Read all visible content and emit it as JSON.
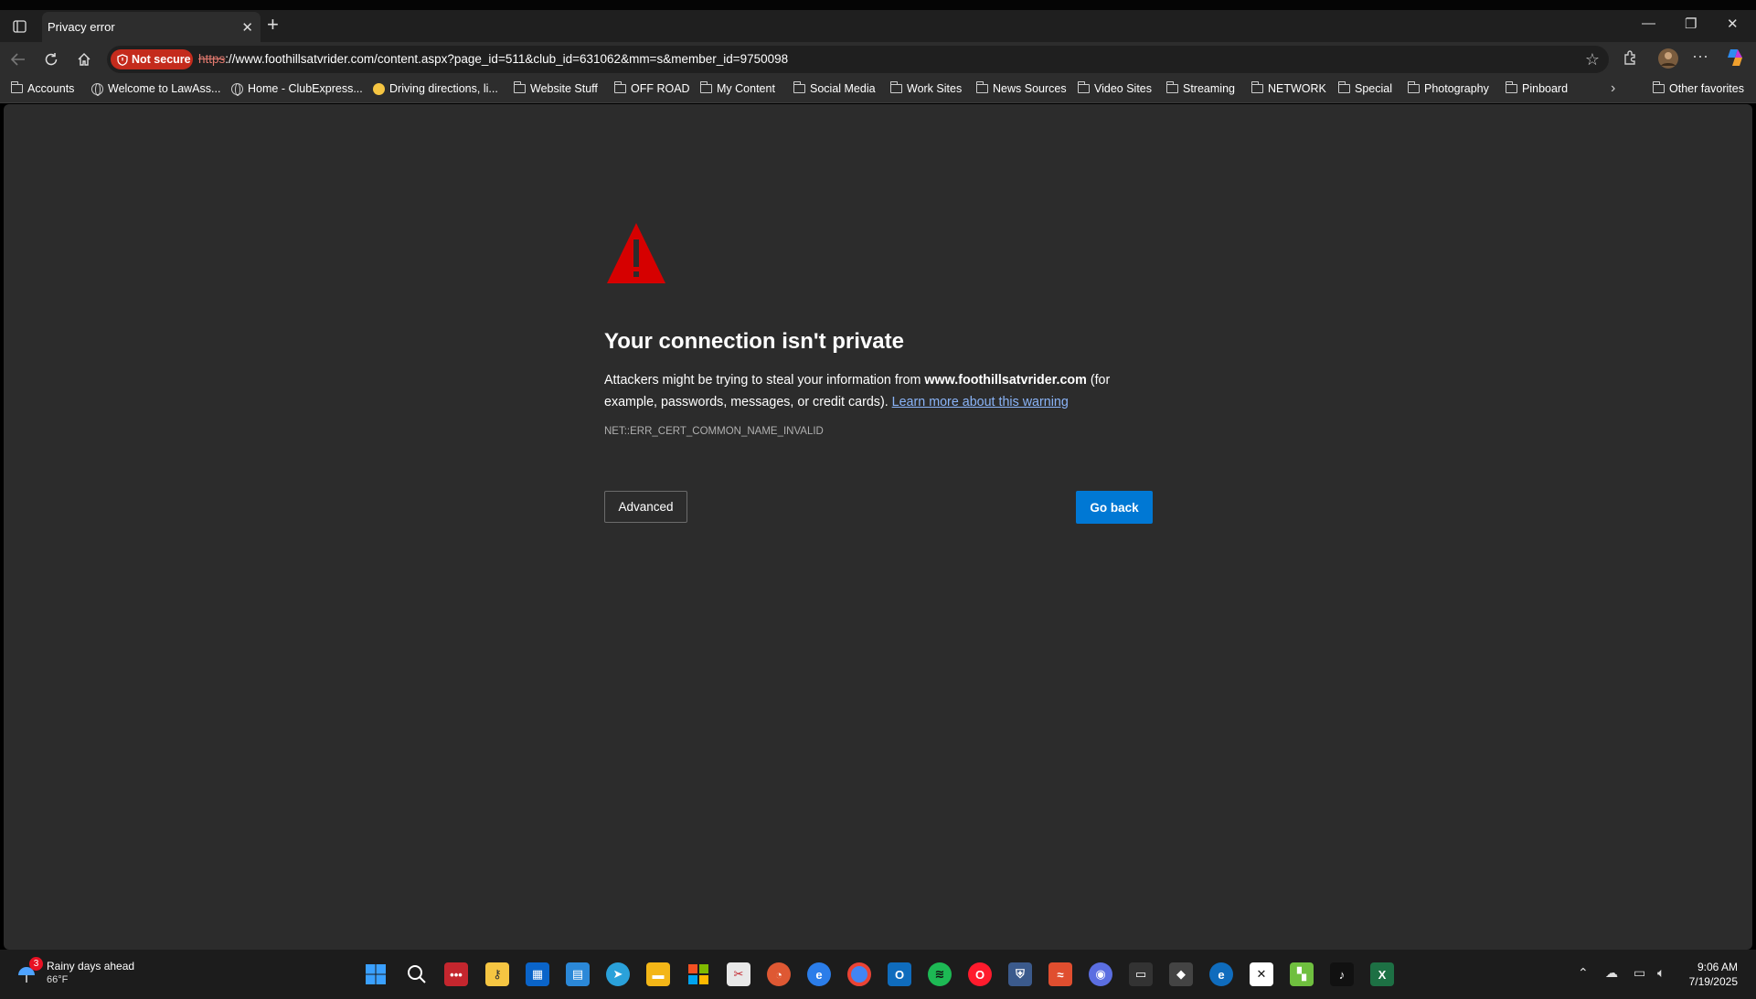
{
  "tab": {
    "title": "Privacy error"
  },
  "address_bar": {
    "security_label": "Not secure",
    "url_scheme": "https",
    "url_rest": "://www.foothillsatvrider.com/content.aspx?page_id=511&club_id=631062&mm=s&member_id=9750098"
  },
  "favorites": [
    {
      "label": "Accounts",
      "icon": "folder-icon"
    },
    {
      "label": "Welcome to LawAss...",
      "icon": "globe-icon"
    },
    {
      "label": "Home - ClubExpress...",
      "icon": "globe-icon"
    },
    {
      "label": "Driving directions, li...",
      "icon": "maps-icon"
    },
    {
      "label": "Website Stuff",
      "icon": "folder-icon"
    },
    {
      "label": "OFF ROAD",
      "icon": "folder-icon"
    },
    {
      "label": "My Content",
      "icon": "folder-icon"
    },
    {
      "label": "Social Media",
      "icon": "folder-icon"
    },
    {
      "label": "Work Sites",
      "icon": "folder-icon"
    },
    {
      "label": "News Sources",
      "icon": "folder-icon"
    },
    {
      "label": "Video Sites",
      "icon": "folder-icon"
    },
    {
      "label": "Streaming",
      "icon": "folder-icon"
    },
    {
      "label": "NETWORK",
      "icon": "folder-icon"
    },
    {
      "label": "Special",
      "icon": "folder-icon"
    },
    {
      "label": "Photography",
      "icon": "folder-icon"
    },
    {
      "label": "Pinboard",
      "icon": "folder-icon"
    }
  ],
  "other_favorites": "Other favorites",
  "error_page": {
    "heading": "Your connection isn't private",
    "desc_prefix": "Attackers might be trying to steal your information from ",
    "domain": "www.foothillsatvrider.com",
    "desc_suffix": " (for example, passwords, messages, or credit cards). ",
    "learn_more": "Learn more about this warning",
    "error_code": "NET::ERR_CERT_COMMON_NAME_INVALID",
    "advanced_label": "Advanced",
    "go_back_label": "Go back"
  },
  "taskbar": {
    "weather_badge": "3",
    "weather_title": "Rainy days ahead",
    "weather_temp": "66°F",
    "time": "9:06 AM",
    "date": "7/19/2025"
  },
  "colors": {
    "warning_red": "#d60000",
    "primary_blue": "#0078d4",
    "link_blue": "#8ab4f8",
    "not_secure_red": "#c42b1c",
    "page_bg": "#2c2c2c"
  }
}
